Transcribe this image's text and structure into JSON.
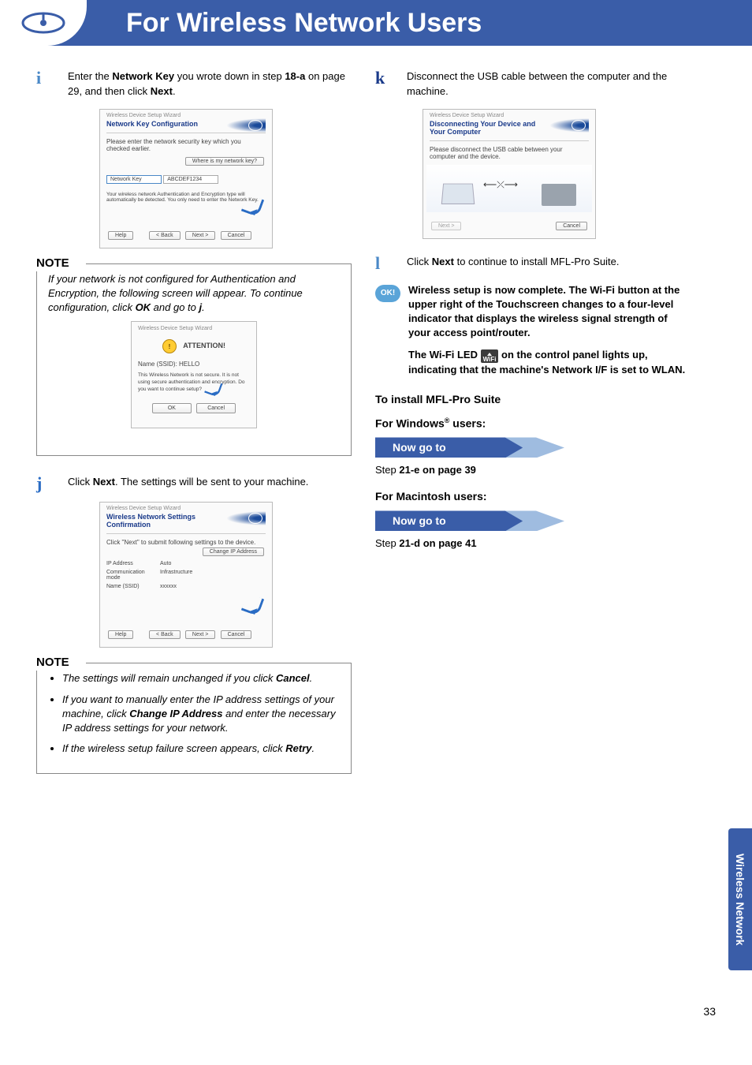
{
  "header": {
    "title": "For Wireless Network Users"
  },
  "left": {
    "step_i": {
      "letter": "i",
      "text_before": "Enter the ",
      "bold1": "Network Key",
      "text_mid1": " you wrote down in step ",
      "bold2": "18-a",
      "text_mid2": " on page 29, and then click ",
      "bold3": "Next",
      "text_after": "."
    },
    "ss1": {
      "head": "Wireless Device Setup Wizard",
      "title": "Network Key Configuration",
      "instr": "Please enter the network security key which you checked earlier.",
      "where_btn": "Where is my network key?",
      "label": "Network Key",
      "value": "ABCDEF1234",
      "footnote": "Your wireless network Authentication and Encryption type will automatically be detected. You only need to enter the Network Key.",
      "help": "Help",
      "back": "< Back",
      "next": "Next >",
      "cancel": "Cancel"
    },
    "note1": {
      "label": "NOTE",
      "text_before": "If your network is not configured for Authentication and Encryption, the following screen will appear. To continue configuration, click ",
      "bold1": "OK",
      "text_mid": " and go to ",
      "bold2": "j",
      "text_after": "."
    },
    "ss2": {
      "head": "Wireless Device Setup Wizard",
      "attention": "ATTENTION!",
      "name_label": "Name (SSID):",
      "name_value": "HELLO",
      "warn": "This Wireless Network is not secure. It is not using secure authentication and encryption. Do you want to continue setup?",
      "ok": "OK",
      "cancel": "Cancel"
    },
    "step_j": {
      "letter": "j",
      "text_before": "Click ",
      "bold1": "Next",
      "text_after": ". The settings will be sent to your machine."
    },
    "ss3": {
      "head": "Wireless Device Setup Wizard",
      "title": "Wireless Network Settings Confirmation",
      "instr": "Click \"Next\" to submit following settings to the device.",
      "rows": [
        {
          "label": "IP Address",
          "value": "Auto"
        },
        {
          "label": "Communication mode",
          "value": "Infrastructure"
        },
        {
          "label": "Name (SSID)",
          "value": "xxxxxx"
        }
      ],
      "change_ip": "Change IP Address",
      "help": "Help",
      "back": "< Back",
      "next": "Next >",
      "cancel": "Cancel"
    },
    "note2": {
      "label": "NOTE",
      "items": [
        {
          "t1": "The settings will remain unchanged if you click ",
          "b": "Cancel",
          "t2": "."
        },
        {
          "t1": "If you want to manually enter the IP address settings of your machine, click ",
          "b": "Change IP Address",
          "t2": " and enter the necessary IP address settings for your network."
        },
        {
          "t1": "If the wireless setup failure screen appears, click ",
          "b": "Retry",
          "t2": "."
        }
      ]
    }
  },
  "right": {
    "step_k": {
      "letter": "k",
      "text": "Disconnect the USB cable between the computer and the machine."
    },
    "ss4": {
      "head": "Wireless Device Setup Wizard",
      "title": "Disconnecting Your Device and Your Computer",
      "instr": "Please disconnect the USB cable between your computer and the device.",
      "next": "Next >",
      "cancel": "Cancel"
    },
    "step_l": {
      "letter": "l",
      "text_before": "Click ",
      "bold1": "Next",
      "text_after": " to continue to install MFL-Pro Suite."
    },
    "ok_label": "OK!",
    "complete": {
      "p1": "Wireless setup is now complete. The Wi-Fi button at the upper right of the Touchscreen changes to a four-level indicator that displays the wireless signal strength of your access point/router.",
      "p2a": "The Wi-Fi LED ",
      "wifi_label": "WiFi",
      "p2b": " on the control panel lights up, indicating that the machine's Network I/F is set to WLAN."
    },
    "install_title": "To install MFL-Pro Suite",
    "windows_title_a": "For Windows",
    "windows_title_b": " users:",
    "goto": "Now go to",
    "win_step_a": "Step ",
    "win_step_b": "21-e",
    "win_step_c": " on page 39",
    "mac_title": "For Macintosh users:",
    "mac_step_a": "Step ",
    "mac_step_b": "21-d",
    "mac_step_c": " on page 41"
  },
  "side_tab": "Wireless Network",
  "page_number": "33"
}
